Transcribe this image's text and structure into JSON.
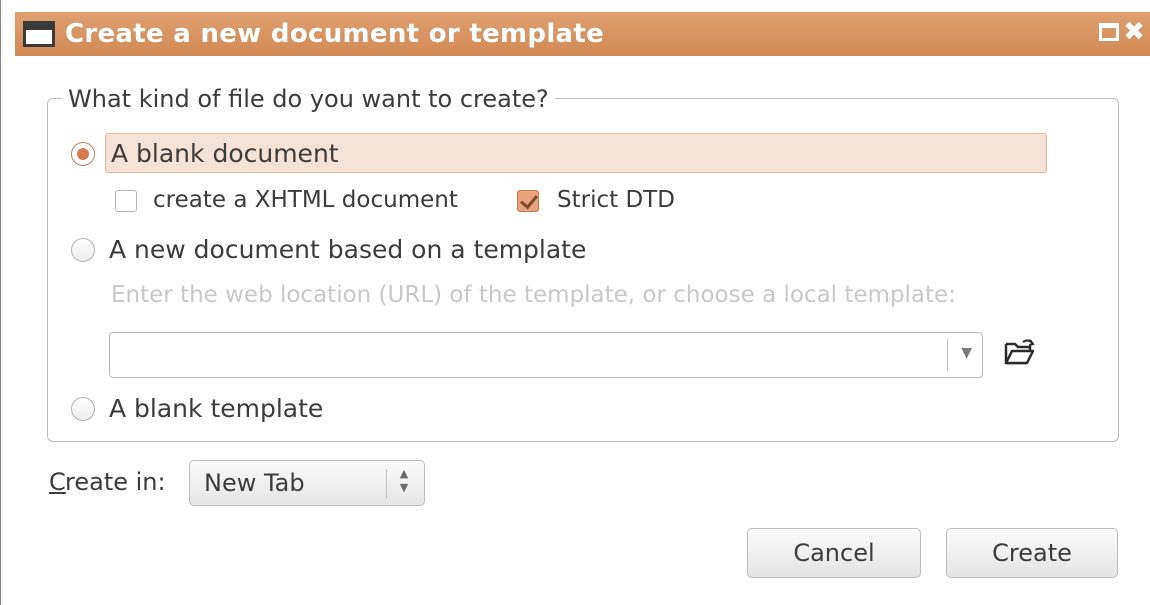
{
  "window": {
    "title": "Create a new document or template"
  },
  "group": {
    "legend": "What kind of file do you want to create?"
  },
  "options": {
    "blank_document": "A blank document",
    "xhtml_checkbox": "create a XHTML document",
    "strict_dtd_checkbox": "Strict DTD",
    "template_based": "A new document based on a template",
    "template_hint": "Enter the web location (URL) of the template, or choose a local template:",
    "template_url_value": "",
    "blank_template": "A blank template"
  },
  "state": {
    "selected_option": "A blank document",
    "xhtml_checked": false,
    "strict_dtd_checked": true
  },
  "create_in": {
    "label_accel": "C",
    "label_rest": "reate in:",
    "value": "New Tab"
  },
  "buttons": {
    "cancel": "Cancel",
    "create": "Create"
  },
  "colors": {
    "accent": "#d97a50",
    "titlebar": "#d8935f"
  },
  "icons": {
    "folder": "open-folder-icon",
    "dropdown": "dropdown-arrow-icon",
    "spin": "spin-arrows-icon"
  }
}
